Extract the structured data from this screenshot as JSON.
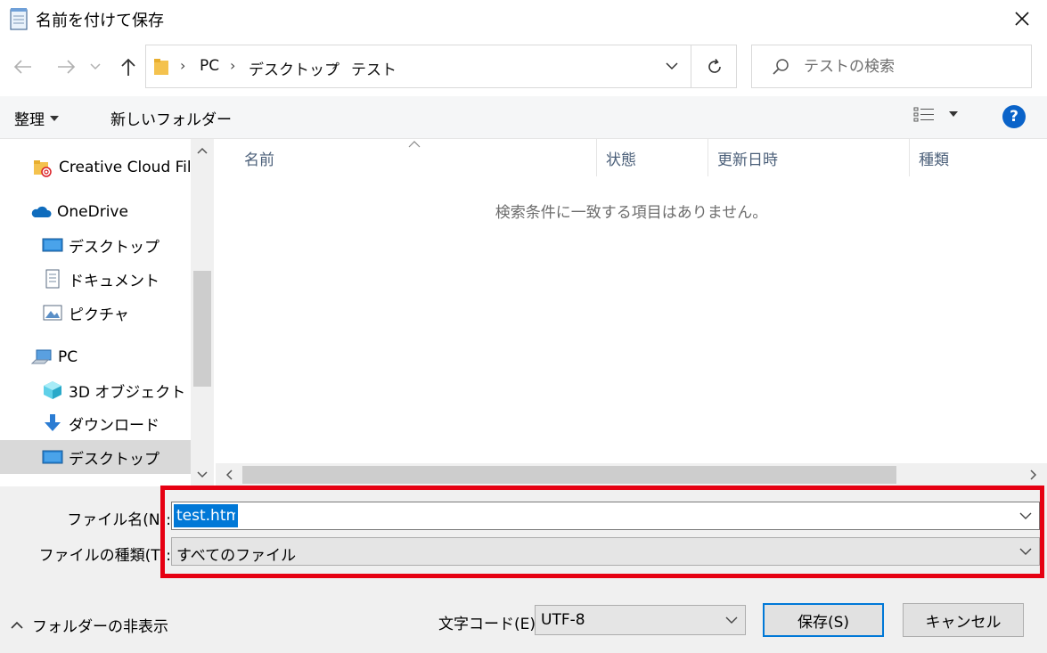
{
  "window": {
    "title": "名前を付けて保存",
    "close_glyph": "✕"
  },
  "address": {
    "crumbs": [
      "PC",
      "デスクトップ",
      "テスト"
    ],
    "separator": "›"
  },
  "search": {
    "placeholder": "テストの検索"
  },
  "toolbar": {
    "organize_label": "整理",
    "new_folder_label": "新しいフォルダー",
    "help_label": "?"
  },
  "navpane": {
    "items": [
      {
        "label": "Creative Cloud Files",
        "icon": "creative-cloud-folder-icon"
      },
      {
        "label": "OneDrive",
        "icon": "onedrive-cloud-icon"
      },
      {
        "label": "デスクトップ",
        "icon": "desktop-icon"
      },
      {
        "label": "ドキュメント",
        "icon": "document-icon"
      },
      {
        "label": "ピクチャ",
        "icon": "picture-icon"
      },
      {
        "label": "PC",
        "icon": "pc-icon"
      },
      {
        "label": "3D オブジェクト",
        "icon": "3d-object-icon"
      },
      {
        "label": "ダウンロード",
        "icon": "download-arrow-icon"
      },
      {
        "label": "デスクトップ",
        "icon": "desktop-icon",
        "selected": true
      }
    ]
  },
  "filelist": {
    "columns": [
      "名前",
      "状態",
      "更新日時",
      "種類"
    ],
    "empty_message": "検索条件に一致する項目はありません。"
  },
  "form": {
    "filename_label": "ファイル名(N):",
    "filename_value": "test.html",
    "filetype_label": "ファイルの種類(T):",
    "filetype_value": "すべてのファイル",
    "encoding_label": "文字コード(E):",
    "encoding_value": "UTF-8"
  },
  "footer": {
    "hide_folders_label": "フォルダーの非表示",
    "save_label": "保存(S)",
    "cancel_label": "キャンセル"
  },
  "colors": {
    "accent": "#0078d7",
    "highlight_box": "#e60012",
    "help": "#0a63c9"
  }
}
